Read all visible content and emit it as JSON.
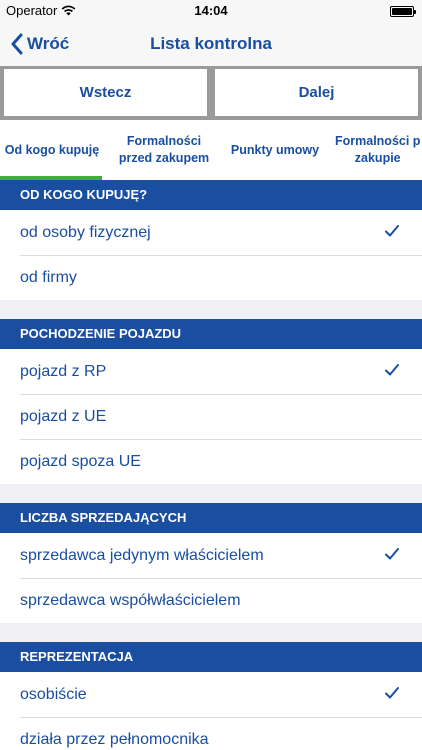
{
  "status_bar": {
    "carrier": "Operator",
    "time": "14:04"
  },
  "nav": {
    "back_label": "Wróć",
    "title": "Lista kontrolna"
  },
  "buttons": {
    "prev": "Wstecz",
    "next": "Dalej"
  },
  "tabs": [
    {
      "line1": "Od kogo kupuję",
      "line2": ""
    },
    {
      "line1": "Formalności",
      "line2": "przed zakupem"
    },
    {
      "line1": "Punkty umowy",
      "line2": ""
    },
    {
      "line1": "Formalności p",
      "line2": "zakupie"
    }
  ],
  "active_tab": 0,
  "sections": [
    {
      "header": "OD KOGO KUPUJĘ?",
      "items": [
        {
          "label": "od osoby fizycznej",
          "checked": true
        },
        {
          "label": "od firmy",
          "checked": false
        }
      ]
    },
    {
      "header": "POCHODZENIE POJAZDU",
      "items": [
        {
          "label": "pojazd z RP",
          "checked": true
        },
        {
          "label": "pojazd z UE",
          "checked": false
        },
        {
          "label": "pojazd spoza UE",
          "checked": false
        }
      ]
    },
    {
      "header": "LICZBA SPRZEDAJĄCYCH",
      "items": [
        {
          "label": "sprzedawca jedynym właścicielem",
          "checked": true
        },
        {
          "label": "sprzedawca współwłaścicielem",
          "checked": false
        }
      ]
    },
    {
      "header": "REPREZENTACJA",
      "items": [
        {
          "label": "osobiście",
          "checked": true
        },
        {
          "label": "działa przez pełnomocnika",
          "checked": false
        }
      ]
    }
  ],
  "colors": {
    "brand_blue": "#1a4ea0",
    "active_tab_indicator": "#3fae3a"
  }
}
